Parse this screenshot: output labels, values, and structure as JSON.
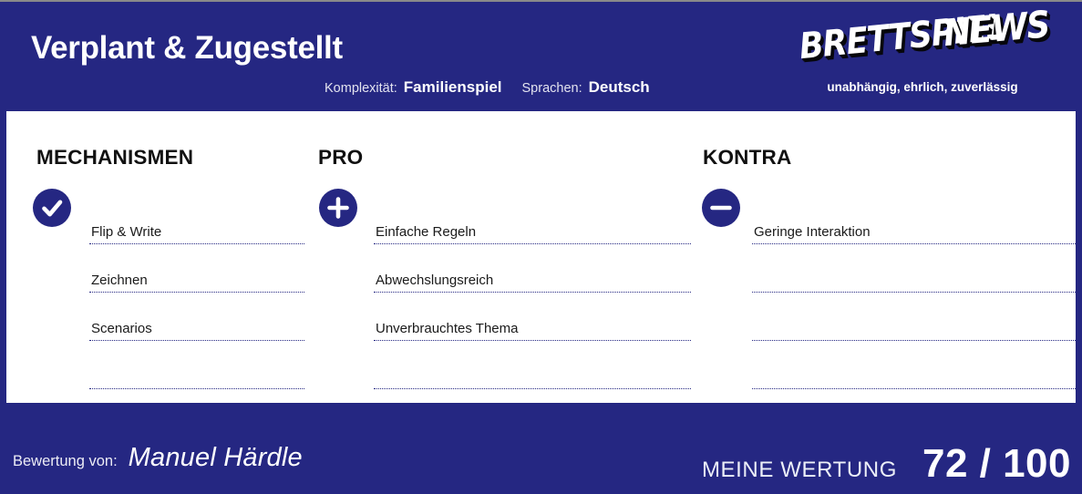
{
  "header": {
    "game_title": "Verplant & Zugestellt",
    "meta": [
      {
        "label": "Komplexität:",
        "value": "Familienspiel"
      },
      {
        "label": "Sprachen:",
        "value": "Deutsch"
      }
    ],
    "logo": {
      "word1": "BRETTSPIEL",
      "word2": "NEWS",
      "tagline": "unabhängig, ehrlich, zuverlässig"
    }
  },
  "columns": [
    {
      "heading": "MECHANISMEN",
      "icon": "check-circle-icon",
      "entries": [
        "Flip & Write",
        "Zeichnen",
        "Scenarios",
        ""
      ]
    },
    {
      "heading": "PRO",
      "icon": "plus-circle-icon",
      "entries": [
        "Einfache Regeln",
        "Abwechslungsreich",
        "Unverbrauchtes Thema",
        ""
      ]
    },
    {
      "heading": "KONTRA",
      "icon": "minus-circle-icon",
      "entries": [
        "Geringe Interaktion",
        "",
        "",
        ""
      ]
    }
  ],
  "footer": {
    "reviewer_label": "Bewertung von:",
    "reviewer_name": "Manuel Härdle",
    "score_label": "MEINE WERTUNG",
    "score_value": "72 / 100"
  },
  "colors": {
    "brand_blue": "#252782",
    "card_background": "#ffffff",
    "text_dark": "#1a1a1a",
    "dotted_rule": "#252782"
  }
}
